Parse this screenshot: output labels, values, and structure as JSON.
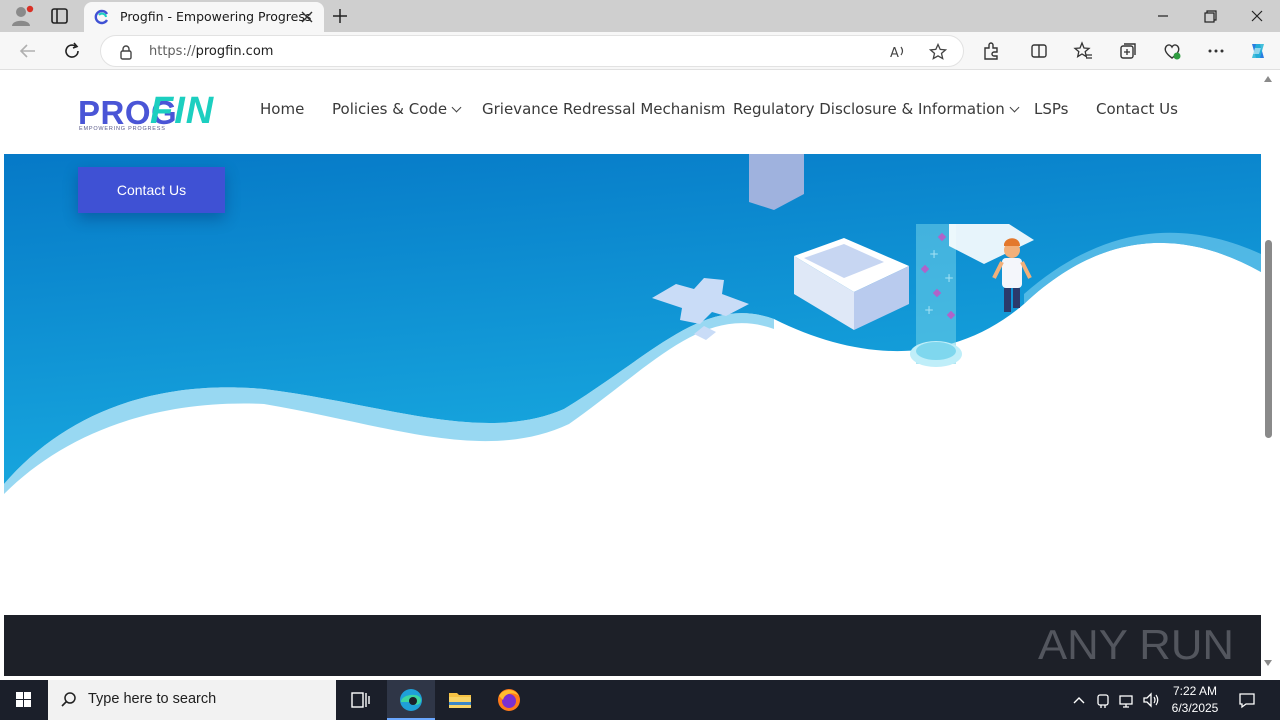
{
  "browser": {
    "tab_title": "Progfin - Empowering Progress",
    "url_prefix": "https://",
    "url_domain": "progfin.com"
  },
  "site": {
    "logo": {
      "part1": "PROG",
      "part2": "FIN",
      "tagline": "EMPOWERING PROGRESS",
      "color_primary": "#4a55d6",
      "color_accent": "#1ccfc0"
    },
    "menu": [
      {
        "label": "Home"
      },
      {
        "label": "Policies & Code"
      },
      {
        "label": "Grievance Redressal Mechanism"
      },
      {
        "label": "Regulatory Disclosure & Information"
      },
      {
        "label": "LSPs"
      },
      {
        "label": "Contact Us"
      }
    ],
    "hero_button": "Contact Us",
    "colors": {
      "hero_blue": "#0a8ad1",
      "button_blue": "#3f51d4",
      "footer": "#1d2028"
    }
  },
  "watermark": "ANY RUN",
  "taskbar": {
    "search_placeholder": "Type here to search",
    "time": "7:22 AM",
    "date": "6/3/2025"
  }
}
